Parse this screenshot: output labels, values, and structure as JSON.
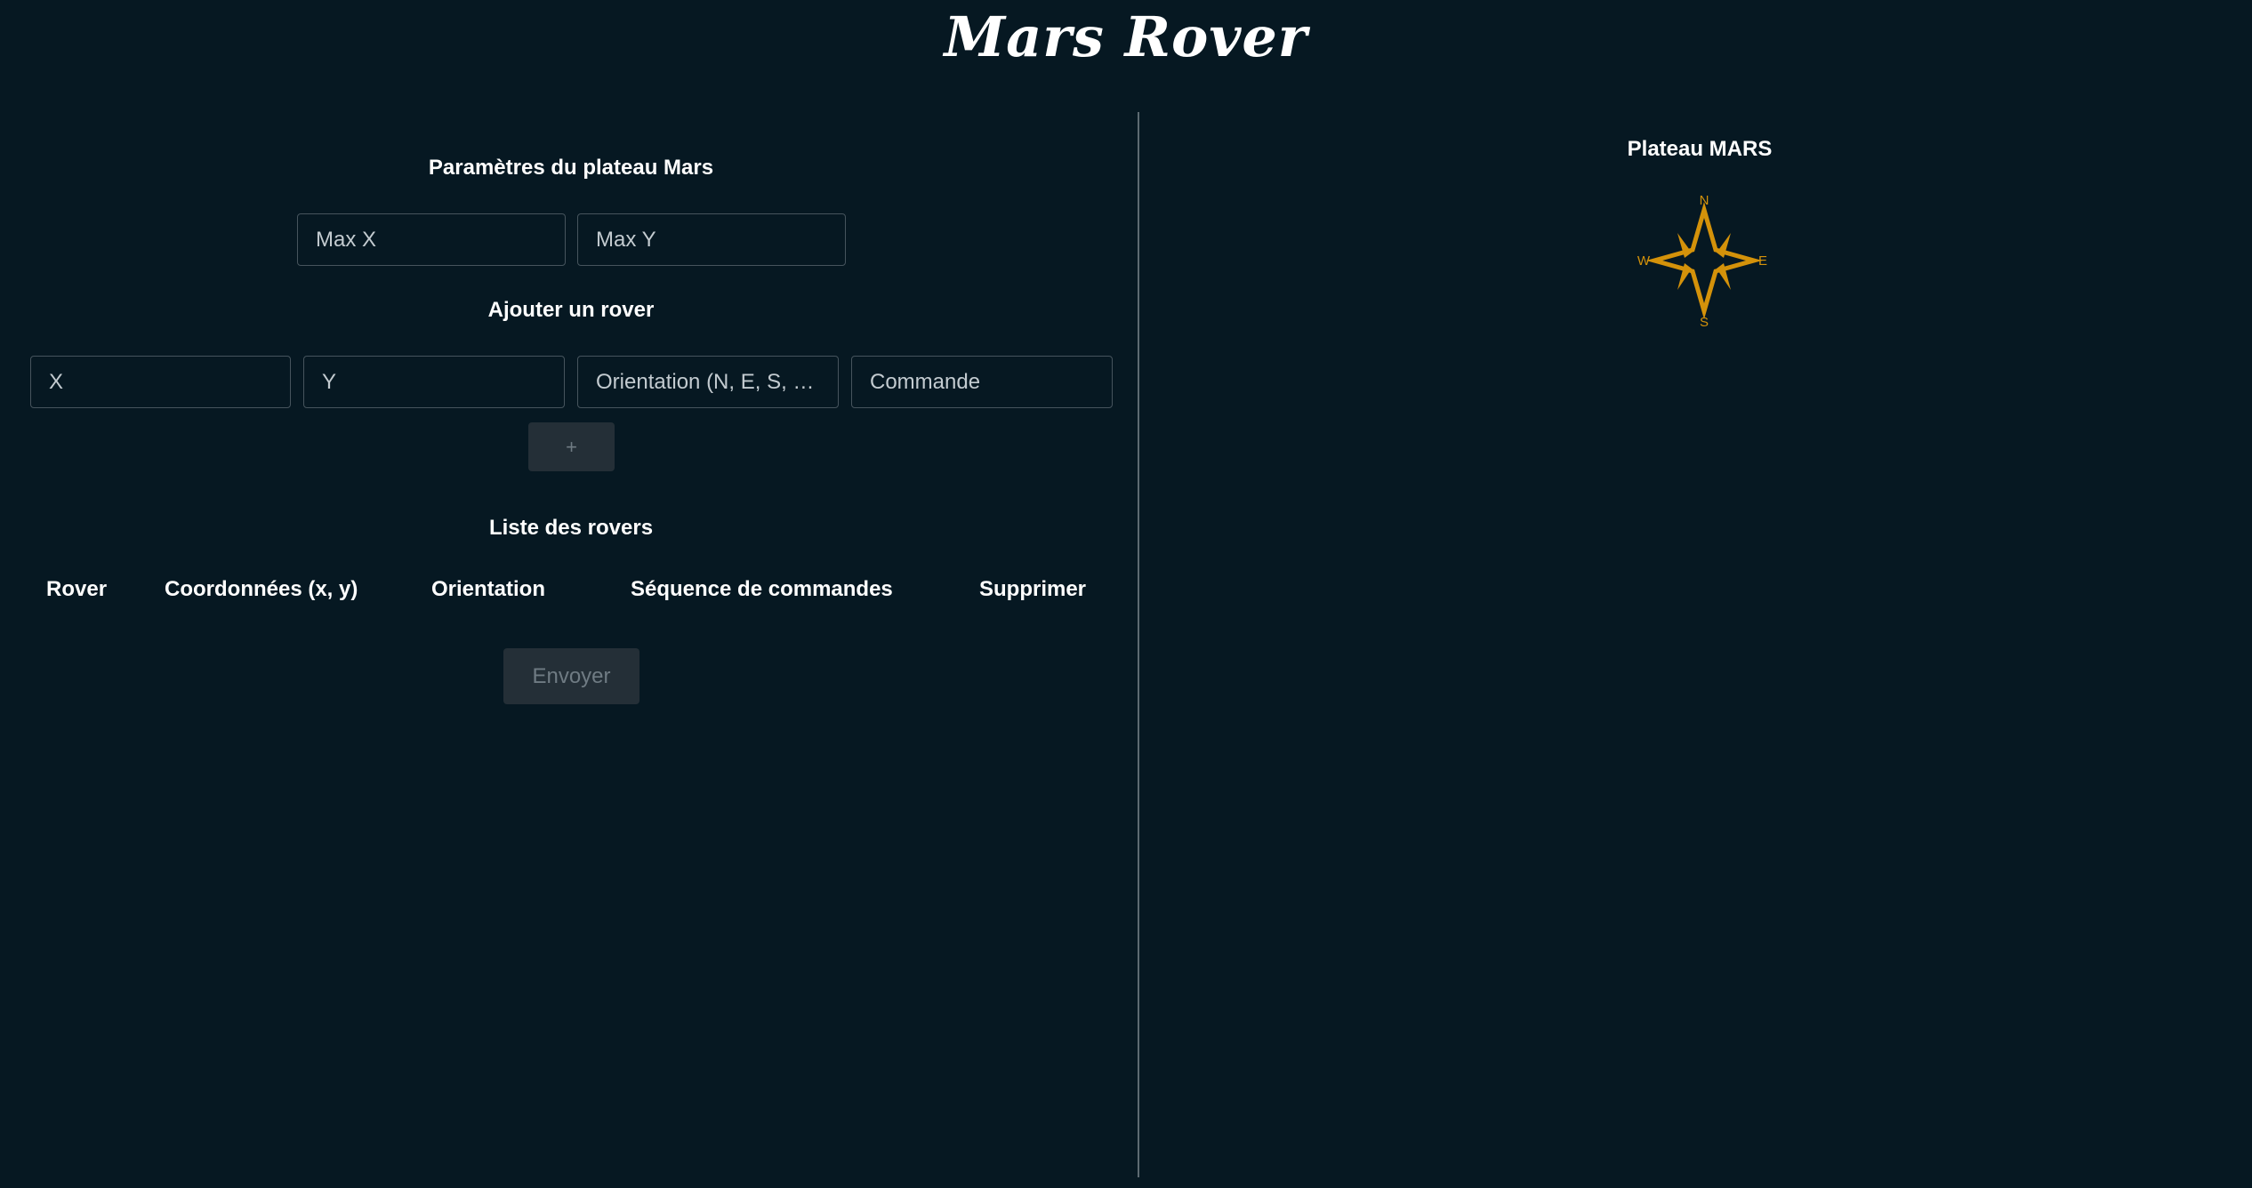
{
  "app": {
    "title": "Mars Rover"
  },
  "plateau_params": {
    "title": "Paramètres du plateau Mars",
    "max_x_placeholder": "Max X",
    "max_y_placeholder": "Max Y"
  },
  "add_rover": {
    "title": "Ajouter un rover",
    "x_placeholder": "X",
    "y_placeholder": "Y",
    "orientation_placeholder": "Orientation (N, E, S, W)",
    "command_placeholder": "Commande",
    "add_button_label": "+"
  },
  "rover_list": {
    "title": "Liste des rovers",
    "columns": [
      "Rover",
      "Coordonnées (x, y)",
      "Orientation",
      "Séquence de commandes",
      "Supprimer"
    ],
    "rows": [],
    "submit_label": "Envoyer"
  },
  "plateau_view": {
    "title": "Plateau MARS",
    "compass": {
      "north": "N",
      "east": "E",
      "south": "S",
      "west": "W",
      "color": "#d4920a",
      "icon": "compass-rose-icon"
    }
  }
}
